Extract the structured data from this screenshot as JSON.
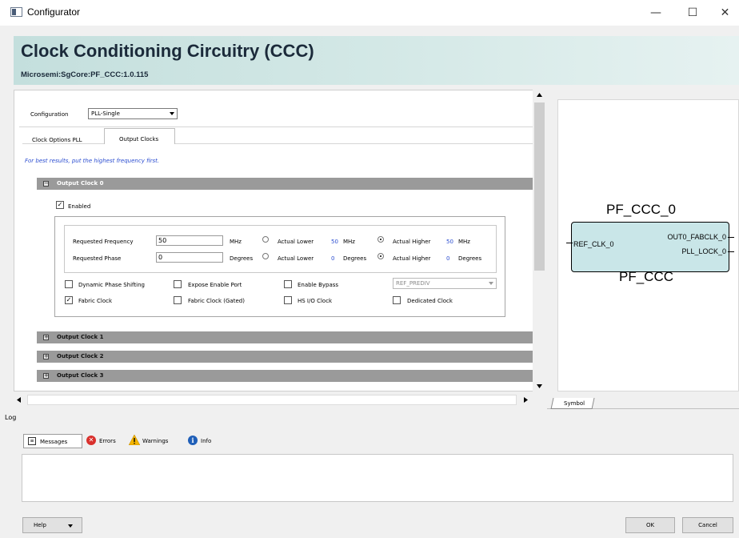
{
  "window": {
    "title": "Configurator",
    "controls": [
      "—",
      "☐",
      "✕"
    ]
  },
  "header": {
    "title": "Clock Conditioning Circuitry (CCC)",
    "subtitle": "Microsemi:SgCore:PF_CCC:1.0.115"
  },
  "configuration": {
    "label": "Configuration",
    "value": "PLL-Single"
  },
  "tabs": [
    {
      "label": "Clock Options PLL",
      "active": false
    },
    {
      "label": "Output Clocks",
      "active": true
    }
  ],
  "hint": "For best results, put the highest frequency first.",
  "output_clock_0": {
    "label": "Output Clock 0",
    "expand": "−",
    "enabled_label": "Enabled",
    "enabled": true,
    "freq": {
      "label": "Requested Frequency",
      "value": "50",
      "unit": "MHz",
      "lower_label": "Actual Lower",
      "lower_value": "50",
      "lower_unit": "MHz",
      "higher_label": "Actual Higher",
      "higher_value": "50",
      "higher_unit": "MHz",
      "selected": "higher"
    },
    "phase": {
      "label": "Requested Phase",
      "value": "0",
      "unit": "Degrees",
      "lower_label": "Actual Lower",
      "lower_value": "0",
      "lower_unit": "Degrees",
      "higher_label": "Actual Higher",
      "higher_value": "0",
      "higher_unit": "Degrees",
      "selected": "higher"
    },
    "options": [
      {
        "label": "Dynamic Phase Shifting",
        "checked": false
      },
      {
        "label": "Expose Enable Port",
        "checked": false
      },
      {
        "label": "Enable Bypass",
        "checked": false
      },
      {
        "label": "Fabric Clock",
        "checked": true
      },
      {
        "label": "Fabric Clock (Gated)",
        "checked": false
      },
      {
        "label": "HS I/O Clock",
        "checked": false
      },
      {
        "label": "Dedicated Clock",
        "checked": false
      }
    ],
    "bypass_select": "REF_PREDIV"
  },
  "collapsed_clocks": [
    {
      "label": "Output Clock 1",
      "expand": "+"
    },
    {
      "label": "Output Clock 2",
      "expand": "+"
    },
    {
      "label": "Output Clock 3",
      "expand": "+"
    }
  ],
  "symbol": {
    "instance": "PF_CCC_0",
    "component": "PF_CCC",
    "input_port": "REF_CLK_0",
    "output_ports": [
      "OUT0_FABCLK_0",
      "PLL_LOCK_0"
    ],
    "tab": "Symbol"
  },
  "log": {
    "label": "Log",
    "tabs": [
      {
        "label": "Messages",
        "icon": "messages-icon"
      },
      {
        "label": "Errors",
        "icon": "error-icon"
      },
      {
        "label": "Warnings",
        "icon": "warning-icon"
      },
      {
        "label": "Info",
        "icon": "info-icon"
      }
    ]
  },
  "buttons": {
    "help": "Help",
    "ok": "OK",
    "cancel": "Cancel"
  },
  "glyphs": {
    "check": "✓"
  },
  "colors": {
    "header_bg": "#c4dfdd",
    "block_fill": "#c9e6e8",
    "hint_text": "#2b4dd0"
  }
}
